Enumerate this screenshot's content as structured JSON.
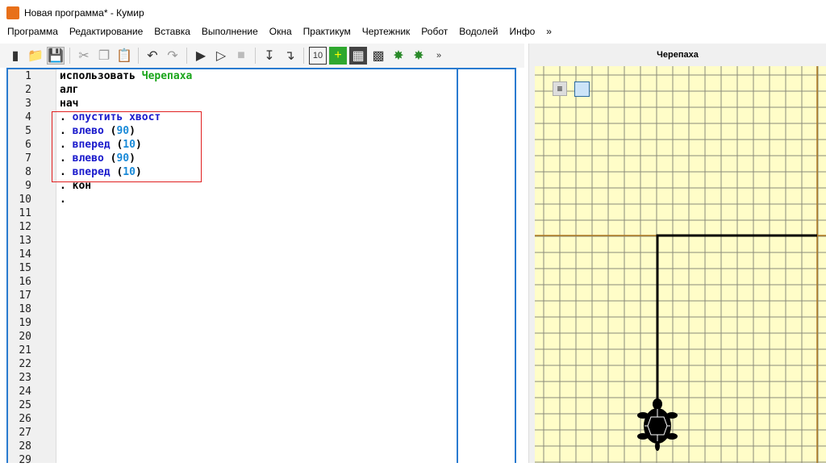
{
  "window": {
    "title": "Новая программа* - Кумир",
    "logo": "K"
  },
  "menu": [
    "Программа",
    "Редактирование",
    "Вставка",
    "Выполнение",
    "Окна",
    "Практикум",
    "Чертежник",
    "Робот",
    "Водолей",
    "Инфо",
    "»"
  ],
  "toolbar": {
    "icons": [
      "new-file",
      "open-folder",
      "save",
      "cut",
      "copy",
      "paste",
      "undo",
      "redo",
      "run",
      "step",
      "stop",
      "step-in",
      "step-out",
      "counter",
      "grid-green",
      "grid-dark",
      "robot-field",
      "turtle",
      "turtle-robot"
    ],
    "more": "»"
  },
  "editor": {
    "line_numbers": [
      "1",
      "2",
      "3",
      "4",
      "5",
      "6",
      "7",
      "8",
      "9",
      "10",
      "11",
      "12",
      "13",
      "14",
      "15",
      "16",
      "17",
      "18",
      "19",
      "20",
      "21",
      "22",
      "23",
      "24",
      "25",
      "26",
      "27",
      "28",
      "29"
    ],
    "lines": [
      {
        "a": "использовать ",
        "b": "Черепаха"
      },
      {
        "a": "алг"
      },
      {
        "a": "нач"
      },
      {
        "dot": ". ",
        "cmd": "опустить хвост"
      },
      {
        "dot": ". ",
        "cmd": "влево",
        "p": " (",
        "n": "90",
        "q": ")"
      },
      {
        "dot": ". ",
        "cmd": "вперед",
        "p": " (",
        "n": "10",
        "q": ")"
      },
      {
        "dot": ". ",
        "cmd": "влево",
        "p": " (",
        "n": "90",
        "q": ")"
      },
      {
        "dot": ". ",
        "cmd": "вперед",
        "p": " (",
        "n": "10",
        "q": ")"
      },
      {
        "dot": ". ",
        "a": "кон"
      },
      {
        "dot": "."
      }
    ]
  },
  "turtle_panel": {
    "title": "Черепаха",
    "colors": {
      "background": "#fffdc8",
      "grid": "#8a8a7a",
      "axis": "#b07a20",
      "path": "#000000"
    }
  }
}
